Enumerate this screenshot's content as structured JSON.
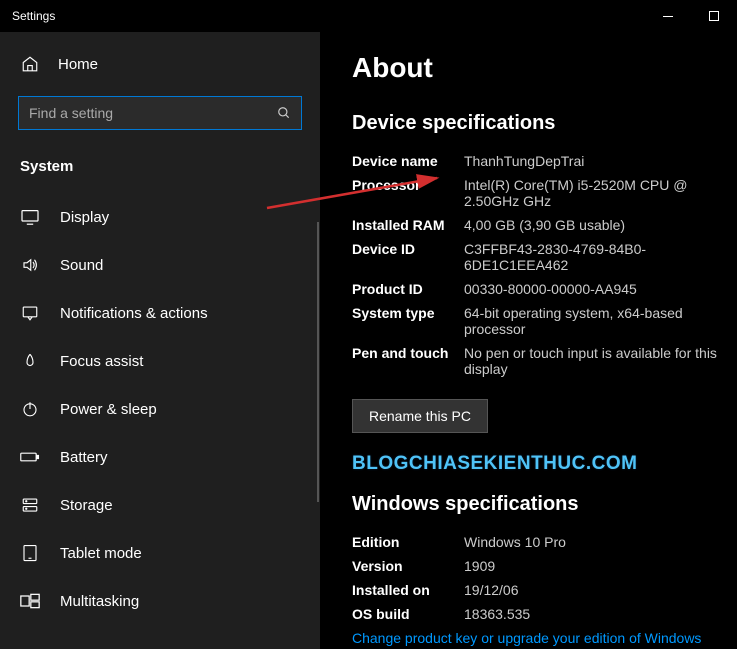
{
  "window": {
    "title": "Settings"
  },
  "sidebar": {
    "home_label": "Home",
    "search_placeholder": "Find a setting",
    "section_label": "System",
    "items": [
      {
        "label": "Display"
      },
      {
        "label": "Sound"
      },
      {
        "label": "Notifications & actions"
      },
      {
        "label": "Focus assist"
      },
      {
        "label": "Power & sleep"
      },
      {
        "label": "Battery"
      },
      {
        "label": "Storage"
      },
      {
        "label": "Tablet mode"
      },
      {
        "label": "Multitasking"
      }
    ]
  },
  "content": {
    "title": "About",
    "device_section": "Device specifications",
    "specs": {
      "device_name_label": "Device name",
      "device_name_value": "ThanhTungDepTrai",
      "processor_label": "Processor",
      "processor_value": "Intel(R) Core(TM) i5-2520M CPU @ 2.50GHz GHz",
      "ram_label": "Installed RAM",
      "ram_value": "4,00 GB (3,90 GB usable)",
      "device_id_label": "Device ID",
      "device_id_value": "C3FFBF43-2830-4769-84B0-6DE1C1EEA462",
      "product_id_label": "Product ID",
      "product_id_value": "00330-80000-00000-AA945",
      "system_type_label": "System type",
      "system_type_value": "64-bit operating system, x64-based processor",
      "pen_label": "Pen and touch",
      "pen_value": "No pen or touch input is available for this display"
    },
    "rename_button": "Rename this PC",
    "watermark": "BLOGCHIASEKIENTHUC.COM",
    "windows_section": "Windows specifications",
    "winspecs": {
      "edition_label": "Edition",
      "edition_value": "Windows 10 Pro",
      "version_label": "Version",
      "version_value": "1909",
      "installed_label": "Installed on",
      "installed_value": "19/12/06",
      "build_label": "OS build",
      "build_value": "18363.535"
    },
    "upgrade_link": "Change product key or upgrade your edition of Windows"
  }
}
